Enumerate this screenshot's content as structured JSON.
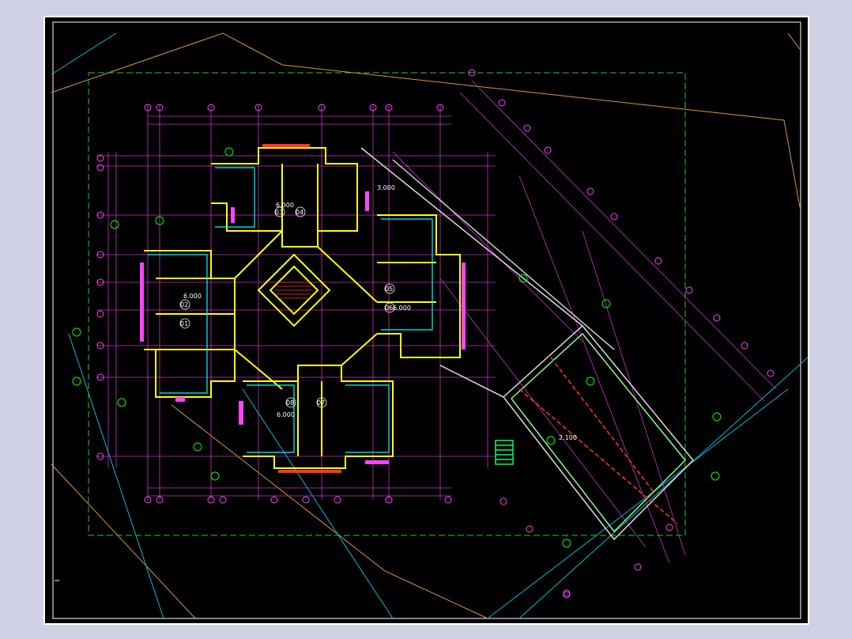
{
  "colors": {
    "background": "#000000",
    "outer": "#cfd0e4",
    "frame": "#ffffff",
    "grid": "#ff00ff",
    "walls": "#ffff00",
    "green": "#00ff00",
    "cyan": "#00ffff",
    "orange": "#d89a2a",
    "red": "#ff2020"
  },
  "room_labels": [
    {
      "key": "u03",
      "text": "03"
    },
    {
      "key": "u04",
      "text": "04"
    },
    {
      "key": "u02",
      "text": "02"
    },
    {
      "key": "u01",
      "text": "01"
    },
    {
      "key": "u05",
      "text": "05"
    },
    {
      "key": "u06",
      "text": "06"
    },
    {
      "key": "u08",
      "text": "08"
    },
    {
      "key": "u07",
      "text": "07"
    }
  ],
  "elevations": {
    "e1": "6.000",
    "e2": "6.000",
    "e3": "3.000",
    "e4": "6.000",
    "e5": "6.000",
    "e6": "2.100"
  }
}
